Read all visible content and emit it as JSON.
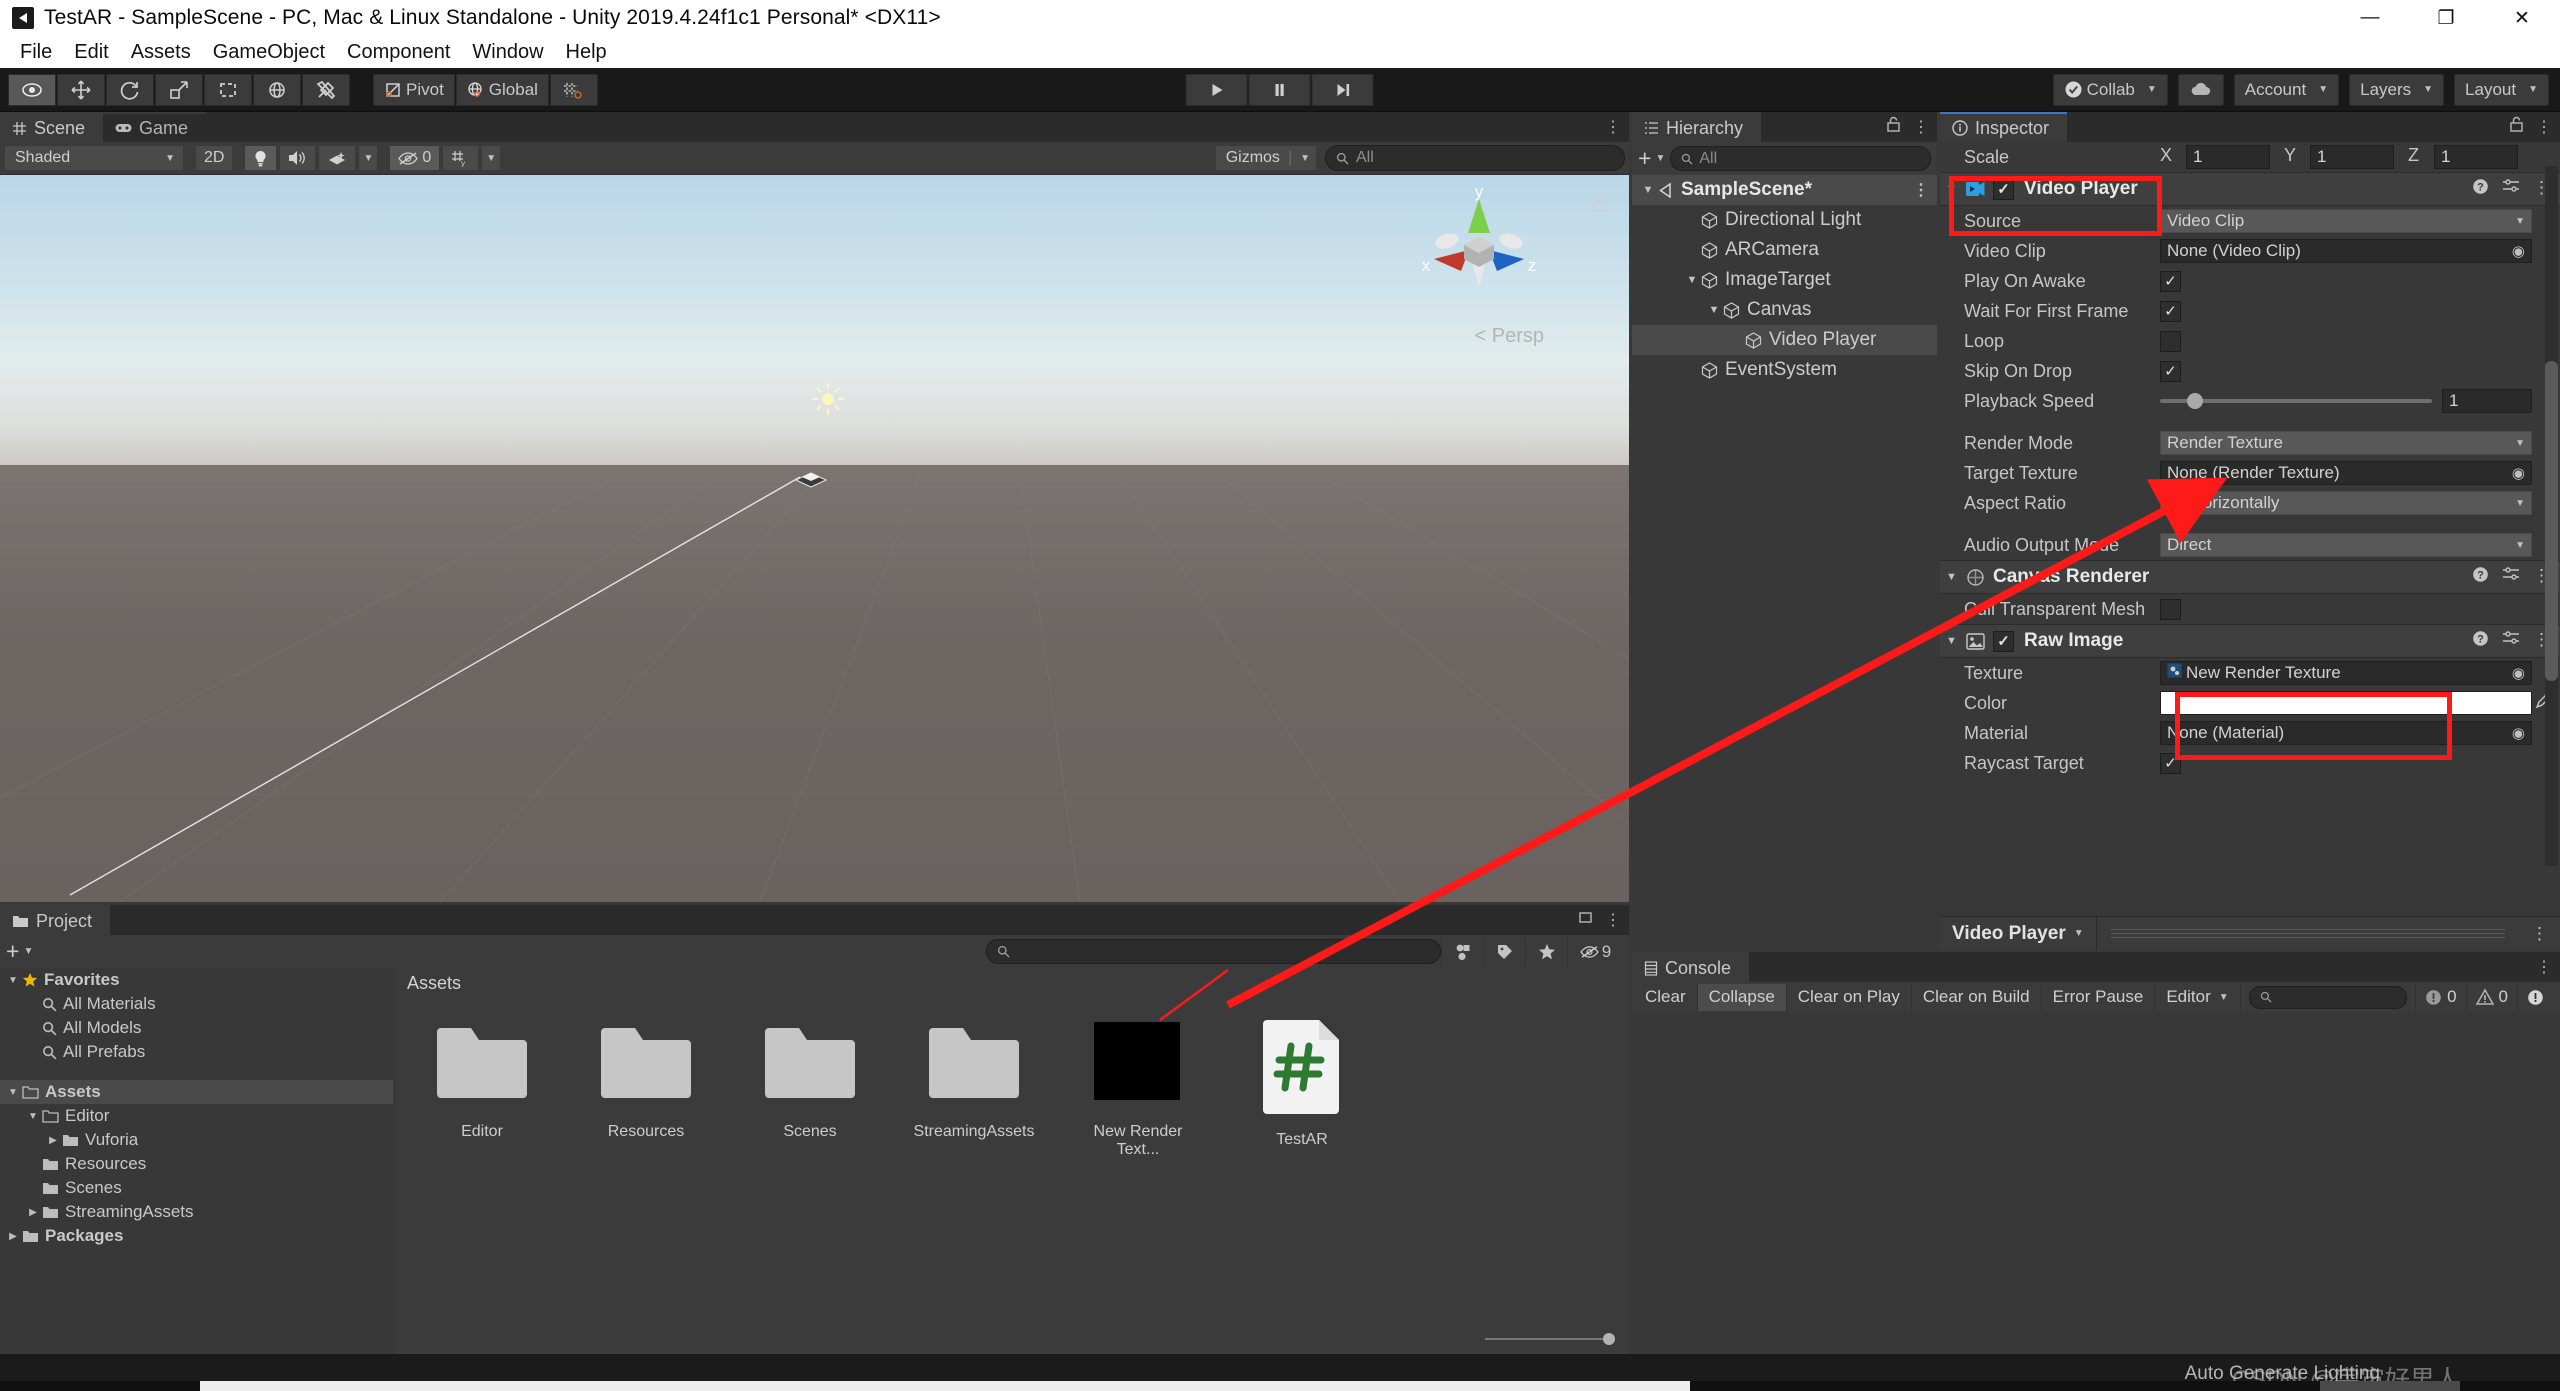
{
  "window": {
    "title": "TestAR - SampleScene - PC, Mac & Linux Standalone - Unity 2019.4.24f1c1 Personal* <DX11>",
    "app_icon": "unity-icon",
    "minimize": "—",
    "maximize": "❐",
    "close": "✕"
  },
  "menu": {
    "items": [
      "File",
      "Edit",
      "Assets",
      "GameObject",
      "Component",
      "Window",
      "Help"
    ]
  },
  "toolbar": {
    "tools": [
      {
        "name": "hand-tool",
        "glyph": "◉"
      },
      {
        "name": "move-tool",
        "glyph": "✚"
      },
      {
        "name": "rotate-tool",
        "glyph": "↺"
      },
      {
        "name": "scale-tool",
        "glyph": "⤡"
      },
      {
        "name": "rect-tool",
        "glyph": "⬚"
      },
      {
        "name": "transform-tool",
        "glyph": "✣"
      },
      {
        "name": "custom-tool",
        "glyph": "⚒"
      }
    ],
    "pivot_label": "Pivot",
    "global_label": "Global",
    "snap_label": "snap-grid",
    "play_label": "▶",
    "pause_label": "⏸",
    "step_label": "⏭",
    "collab_label": "Collab",
    "cloud_label": "cloud-icon",
    "account_label": "Account",
    "layers_label": "Layers",
    "layout_label": "Layout"
  },
  "scene": {
    "tabs": [
      {
        "label": "Scene",
        "icon": "grid-icon",
        "selected": true
      },
      {
        "label": "Game",
        "icon": "gamepad-icon",
        "selected": false
      }
    ],
    "shading_mode": "Shaded",
    "toggle_2d": "2D",
    "light_icon": "lightbulb-icon",
    "audio_icon": "speaker-icon",
    "fx_icon": "fx-icon",
    "hidden_count": "0",
    "grid_icon": "grid-visibility-icon",
    "gizmos_label": "Gizmos",
    "search_placeholder": "All",
    "persp_label": "Persp",
    "axis_x": "x",
    "axis_y": "y",
    "axis_z": "z"
  },
  "hierarchy": {
    "tab_label": "Hierarchy",
    "add_label": "+",
    "search_placeholder": "All",
    "items": [
      {
        "label": "SampleScene*",
        "depth": 0,
        "expanded": true,
        "is_scene": true,
        "selected": false
      },
      {
        "label": "Directional Light",
        "depth": 2,
        "expanded": null,
        "is_scene": false,
        "selected": false
      },
      {
        "label": "ARCamera",
        "depth": 2,
        "expanded": null,
        "is_scene": false,
        "selected": false
      },
      {
        "label": "ImageTarget",
        "depth": 2,
        "expanded": true,
        "is_scene": false,
        "selected": false
      },
      {
        "label": "Canvas",
        "depth": 3,
        "expanded": true,
        "is_scene": false,
        "selected": false
      },
      {
        "label": "Video Player",
        "depth": 4,
        "expanded": null,
        "is_scene": false,
        "selected": true
      },
      {
        "label": "EventSystem",
        "depth": 2,
        "expanded": null,
        "is_scene": false,
        "selected": false
      }
    ]
  },
  "inspector": {
    "tab_label": "Inspector",
    "transform_scale": {
      "label": "Scale",
      "axes": [
        {
          "axis": "X",
          "value": "1"
        },
        {
          "axis": "Y",
          "value": "1"
        },
        {
          "axis": "Z",
          "value": "1"
        }
      ]
    },
    "components": [
      {
        "name": "Video Player",
        "icon": "video-player-icon",
        "enabled": true,
        "highlighted": true,
        "rows": [
          {
            "label": "Source",
            "type": "dropdown",
            "value": "Video Clip"
          },
          {
            "label": "Video Clip",
            "type": "object",
            "value": "None (Video Clip)"
          },
          {
            "label": "Play On Awake",
            "type": "checkbox",
            "value": true
          },
          {
            "label": "Wait For First Frame",
            "type": "checkbox",
            "value": true
          },
          {
            "label": "Loop",
            "type": "checkbox",
            "value": false
          },
          {
            "label": "Skip On Drop",
            "type": "checkbox",
            "value": true
          },
          {
            "label": "Playback Speed",
            "type": "slider",
            "value": "1"
          },
          {
            "label": "",
            "type": "spacer",
            "value": ""
          },
          {
            "label": "Render Mode",
            "type": "dropdown",
            "value": "Render Texture"
          },
          {
            "label": "Target Texture",
            "type": "object",
            "value": "None (Render Texture)"
          },
          {
            "label": "Aspect Ratio",
            "type": "dropdown",
            "value": "Fit Horizontally"
          },
          {
            "label": "",
            "type": "spacer",
            "value": ""
          },
          {
            "label": "Audio Output Mode",
            "type": "dropdown",
            "value": "Direct"
          }
        ]
      },
      {
        "name": "Canvas Renderer",
        "icon": "canvas-renderer-icon",
        "enabled": null,
        "highlighted": false,
        "rows": [
          {
            "label": "Cull Transparent Mesh",
            "type": "checkbox",
            "value": false
          }
        ]
      },
      {
        "name": "Raw Image",
        "icon": "raw-image-icon",
        "enabled": true,
        "highlighted": false,
        "rows": [
          {
            "label": "Texture",
            "type": "object-tex",
            "value": "New Render Texture"
          },
          {
            "label": "Color",
            "type": "color",
            "value": "#FFFFFF"
          },
          {
            "label": "Material",
            "type": "object",
            "value": "None (Material)"
          },
          {
            "label": "Raycast Target",
            "type": "checkbox",
            "value": true
          }
        ]
      }
    ],
    "footer_label": "Video Player",
    "help_icon": "help-icon",
    "preset_icon": "preset-icon",
    "menu_icon": "kebab-menu-icon"
  },
  "project": {
    "tab_label": "Project",
    "add_label": "+",
    "search_placeholder": "",
    "filter_icons": [
      "asset-type-filter-icon",
      "label-filter-icon",
      "favorite-filter-icon"
    ],
    "hidden_count": "9",
    "breadcrumb": "Assets",
    "tree": [
      {
        "label": "Favorites",
        "depth": 0,
        "arrow": "down",
        "icon": "star-icon",
        "bold": true,
        "selected": false
      },
      {
        "label": "All Materials",
        "depth": 1,
        "arrow": "",
        "icon": "search-icon",
        "bold": false,
        "selected": false
      },
      {
        "label": "All Models",
        "depth": 1,
        "arrow": "",
        "icon": "search-icon",
        "bold": false,
        "selected": false
      },
      {
        "label": "All Prefabs",
        "depth": 1,
        "arrow": "",
        "icon": "search-icon",
        "bold": false,
        "selected": false
      },
      {
        "label": "",
        "depth": 0,
        "arrow": "",
        "icon": "",
        "bold": false,
        "selected": false
      },
      {
        "label": "Assets",
        "depth": 0,
        "arrow": "down",
        "icon": "folder-open-icon",
        "bold": true,
        "selected": true
      },
      {
        "label": "Editor",
        "depth": 1,
        "arrow": "down",
        "icon": "folder-open-icon",
        "bold": false,
        "selected": false
      },
      {
        "label": "Vuforia",
        "depth": 2,
        "arrow": "right",
        "icon": "folder-icon",
        "bold": false,
        "selected": false
      },
      {
        "label": "Resources",
        "depth": 1,
        "arrow": "",
        "icon": "folder-icon",
        "bold": false,
        "selected": false
      },
      {
        "label": "Scenes",
        "depth": 1,
        "arrow": "",
        "icon": "folder-icon",
        "bold": false,
        "selected": false
      },
      {
        "label": "StreamingAssets",
        "depth": 1,
        "arrow": "right",
        "icon": "folder-icon",
        "bold": false,
        "selected": false
      },
      {
        "label": "Packages",
        "depth": 0,
        "arrow": "right",
        "icon": "folder-icon",
        "bold": true,
        "selected": false
      }
    ],
    "assets": [
      {
        "label": "Editor",
        "kind": "folder"
      },
      {
        "label": "Resources",
        "kind": "folder"
      },
      {
        "label": "Scenes",
        "kind": "folder"
      },
      {
        "label": "StreamingAssets",
        "kind": "folder"
      },
      {
        "label": "New Render Text...",
        "kind": "render-texture"
      },
      {
        "label": "TestAR",
        "kind": "csharp-script"
      }
    ]
  },
  "console": {
    "tab_label": "Console",
    "buttons": [
      {
        "label": "Clear",
        "active": false
      },
      {
        "label": "Collapse",
        "active": true
      },
      {
        "label": "Clear on Play",
        "active": false
      },
      {
        "label": "Clear on Build",
        "active": false
      },
      {
        "label": "Error Pause",
        "active": false
      },
      {
        "label": "Editor",
        "active": false
      }
    ],
    "search_placeholder": "",
    "log_count": "0",
    "warn_count": "0",
    "error_count": ""
  },
  "status": {
    "auto_generate": "Auto Generate Lighting",
    "watermark": "CSDN @宇宙好男人"
  },
  "colors": {
    "accent_red": "#ff1a1a",
    "unity_blue": "#2b8fd6",
    "csharp_green": "#2d7a33",
    "panel_bg": "#383838",
    "toolbar_bg": "#3b3b3b",
    "dark_bg": "#191919"
  }
}
